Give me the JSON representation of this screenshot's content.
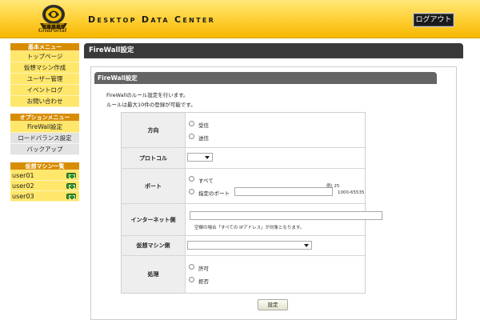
{
  "header": {
    "site_title": "Desktop Data Center",
    "logo_text": "GridPortal",
    "logout_label": "ログアウト"
  },
  "sidebar": {
    "basic_menu": {
      "title": "基本メニュー",
      "items": [
        "トップページ",
        "仮想マシン作成",
        "ユーザー管理",
        "イベントログ",
        "お問い合わせ"
      ]
    },
    "option_menu": {
      "title": "オプションメニュー",
      "items": [
        "FireWall設定",
        "ロードバランス設定",
        "バックアップ"
      ]
    },
    "vm_list": {
      "title": "仮想マシン一覧",
      "items": [
        "user01",
        "user02",
        "user03"
      ]
    }
  },
  "main": {
    "page_title": "FireWall設定",
    "panel_title": "FireWall設定",
    "description": [
      "FireWallのルール設定を行います。",
      "ルールは最大10件の登録が可能です。"
    ]
  },
  "form": {
    "direction": {
      "label": "方向",
      "options": [
        "受信",
        "送信"
      ]
    },
    "protocol": {
      "label": "プロトコル",
      "selected": ""
    },
    "port": {
      "label": "ポート",
      "options": [
        "すべて",
        "指定のポート"
      ],
      "value": "",
      "example_line1": "例) 25",
      "example_line2": "1000-65535"
    },
    "internet_side": {
      "label": "インターネット側",
      "value": "",
      "hint": "空欄の場合「すべての IPアドレス」が対象となります。"
    },
    "vm_side": {
      "label": "仮想マシン側",
      "selected": ""
    },
    "action": {
      "label": "処理",
      "options": [
        "許可",
        "拒否"
      ]
    },
    "submit_label": "設定"
  },
  "colors": {
    "header_yellow": "#ffd23c",
    "menu_orange": "#d88d00",
    "menu_yellow": "#ffe76b",
    "dark_bar": "#3a3a3a"
  }
}
